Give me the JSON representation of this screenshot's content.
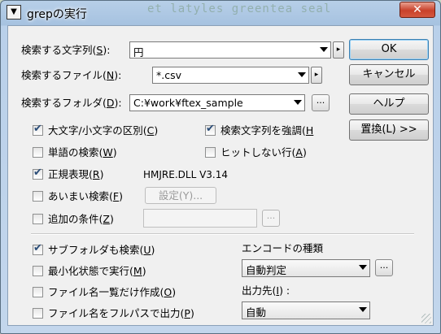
{
  "window": {
    "title": "grepの実行",
    "background_ghost_text": "et latyles greentea seal",
    "close_label": "✕"
  },
  "fields": {
    "search_text": {
      "label": "検索する文字列(",
      "accel": "S",
      "suffix": "):",
      "value": "円"
    },
    "search_file": {
      "label": "検索するファイル(",
      "accel": "N",
      "suffix": "):",
      "value": "*.csv"
    },
    "search_folder": {
      "label": "検索するフォルダ(",
      "accel": "D",
      "suffix": "):",
      "value": "C:¥work¥ftex_sample",
      "browse_label": "..."
    }
  },
  "options": {
    "case_sensitive": {
      "label": "大文字/小文字の区別(",
      "accel": "C",
      "suffix": ")",
      "checked": true
    },
    "highlight": {
      "label": "検索文字列を強調(",
      "accel": "H",
      "suffix": "",
      "checked": true
    },
    "word_search": {
      "label": "単語の検索(",
      "accel": "W",
      "suffix": ")",
      "checked": false
    },
    "non_match": {
      "label": "ヒットしない行(",
      "accel": "A",
      "suffix": ")",
      "checked": false
    },
    "regex": {
      "label": "正規表現(",
      "accel": "R",
      "suffix": ")",
      "checked": true
    },
    "regex_lib": "HMJRE.DLL  V3.14",
    "fuzzy": {
      "label": "あいまい検索(",
      "accel": "F",
      "suffix": ")",
      "checked": false,
      "settings_label": "設定(Y)..."
    },
    "extra_cond": {
      "label": "追加の条件(",
      "accel": "Z",
      "suffix": ")",
      "checked": false,
      "browse_label": "..."
    },
    "subfolders": {
      "label": "サブフォルダも検索(",
      "accel": "U",
      "suffix": ")",
      "checked": true
    },
    "minimized": {
      "label": "最小化状態で実行(",
      "accel": "M",
      "suffix": ")",
      "checked": false
    },
    "filelist_only": {
      "label": "ファイル名一覧だけ作成(",
      "accel": "O",
      "suffix": ")",
      "checked": false
    },
    "fullpath": {
      "label": "ファイル名をフルパスで出力(",
      "accel": "P",
      "suffix": ")",
      "checked": false
    }
  },
  "encoding": {
    "label": "エンコードの種類",
    "value": "自動判定",
    "browse_label": "..."
  },
  "output": {
    "label": "出力先(",
    "accel": "I",
    "suffix": ") :",
    "value": "自動"
  },
  "buttons": {
    "ok": "OK",
    "cancel": "キャンセル",
    "help": "ヘルプ",
    "replace": "置換(L) >>"
  },
  "check_mark": "✔",
  "small_arrow": "▸"
}
